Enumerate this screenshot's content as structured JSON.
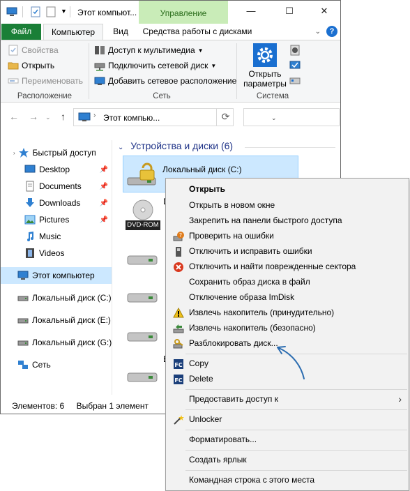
{
  "window": {
    "title": "Этот компьют...",
    "manage_tab": "Управление",
    "controls": {
      "minimize": "—",
      "maximize": "☐",
      "close": "✕"
    }
  },
  "ribbon_tabs": {
    "file": "Файл",
    "computer": "Компьютер",
    "view": "Вид",
    "drive_tools": "Средства работы с дисками",
    "help": "?"
  },
  "ribbon": {
    "location": {
      "properties": "Свойства",
      "open": "Открыть",
      "rename": "Переименовать",
      "group": "Расположение"
    },
    "network": {
      "media_access": "Доступ к мультимедиа",
      "map_drive": "Подключить сетевой диск",
      "add_location": "Добавить сетевое расположение",
      "group": "Сеть"
    },
    "system": {
      "open_settings": "Открыть параметры",
      "group": "Система"
    }
  },
  "address": {
    "path": "Этот компью...",
    "back_icon": "←",
    "forward_icon": "→",
    "up_icon": "↑",
    "refresh_icon": "⟳"
  },
  "nav": {
    "quick_access": "Быстрый доступ",
    "desktop": "Desktop",
    "documents": "Documents",
    "downloads": "Downloads",
    "pictures": "Pictures",
    "music": "Music",
    "videos": "Videos",
    "this_pc": "Этот компьютер",
    "disk_c": "Локальный диск (C:)",
    "disk_e": "Локальный диск (E:)",
    "disk_g": "Локальный диск (G:)",
    "network": "Сеть"
  },
  "content": {
    "group_header": "Устройства и диски (6)",
    "drive_c": "Локальный диск (C:)",
    "dvd_label": "DVD-ROM",
    "drive_letter_d": "D",
    "drive_letter_b": "B"
  },
  "status": {
    "items": "Элементов: 6",
    "selected": "Выбран 1 элемент"
  },
  "context_menu": {
    "open": "Открыть",
    "open_new_window": "Открыть в новом окне",
    "pin_quick": "Закрепить на панели быстрого доступа",
    "check_errors": "Проверить на ошибки",
    "disable_fix": "Отключить и исправить ошибки",
    "disable_bad_sectors": "Отключить и найти поврежденные сектора",
    "save_image": "Сохранить образ диска в файл",
    "disable_imdisk": "Отключение образа ImDisk",
    "eject_force": "Извлечь накопитель (принудительно)",
    "eject_safe": "Извлечь накопитель (безопасно)",
    "unlock_disk": "Разблокировать диск...",
    "copy": "Copy",
    "delete": "Delete",
    "share": "Предоставить доступ к",
    "unlocker": "Unlocker",
    "format": "Форматировать...",
    "create_shortcut": "Создать ярлык",
    "cmd_here": "Командная строка с этого места",
    "submenu_arrow": "›"
  },
  "colors": {
    "file_tab": "#1a7f37",
    "manage_tab": "#c9ecb8",
    "selection": "#cce8ff",
    "accent_blue": "#1a6fd0",
    "annotation_arrow": "#2b6cb0"
  }
}
